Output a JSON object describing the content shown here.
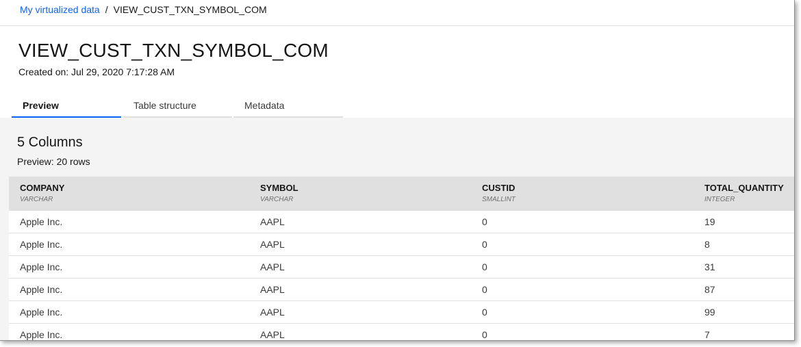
{
  "breadcrumb": {
    "link": "My virtualized data",
    "separator": "/",
    "current": "VIEW_CUST_TXN_SYMBOL_COM"
  },
  "header": {
    "title": "VIEW_CUST_TXN_SYMBOL_COM",
    "created": "Created on: Jul 29, 2020 7:17:28 AM"
  },
  "tabs": [
    {
      "label": "Preview",
      "active": true
    },
    {
      "label": "Table structure",
      "active": false
    },
    {
      "label": "Metadata",
      "active": false
    }
  ],
  "summary": {
    "columns": "5 Columns",
    "preview": "Preview: 20 rows"
  },
  "table": {
    "columns": [
      {
        "name": "COMPANY",
        "type": "VARCHAR"
      },
      {
        "name": "SYMBOL",
        "type": "VARCHAR"
      },
      {
        "name": "CUSTID",
        "type": "SMALLINT"
      },
      {
        "name": "TOTAL_QUANTITY",
        "type": "INTEGER"
      }
    ],
    "rows": [
      [
        "Apple Inc.",
        "AAPL",
        "0",
        "19"
      ],
      [
        "Apple Inc.",
        "AAPL",
        "0",
        "8"
      ],
      [
        "Apple Inc.",
        "AAPL",
        "0",
        "31"
      ],
      [
        "Apple Inc.",
        "AAPL",
        "0",
        "87"
      ],
      [
        "Apple Inc.",
        "AAPL",
        "0",
        "99"
      ],
      [
        "Apple Inc.",
        "AAPL",
        "0",
        "7"
      ]
    ]
  },
  "colors": {
    "accent": "#0f62fe",
    "header_bg": "#e0e0e0",
    "content_bg": "#f4f4f4"
  }
}
